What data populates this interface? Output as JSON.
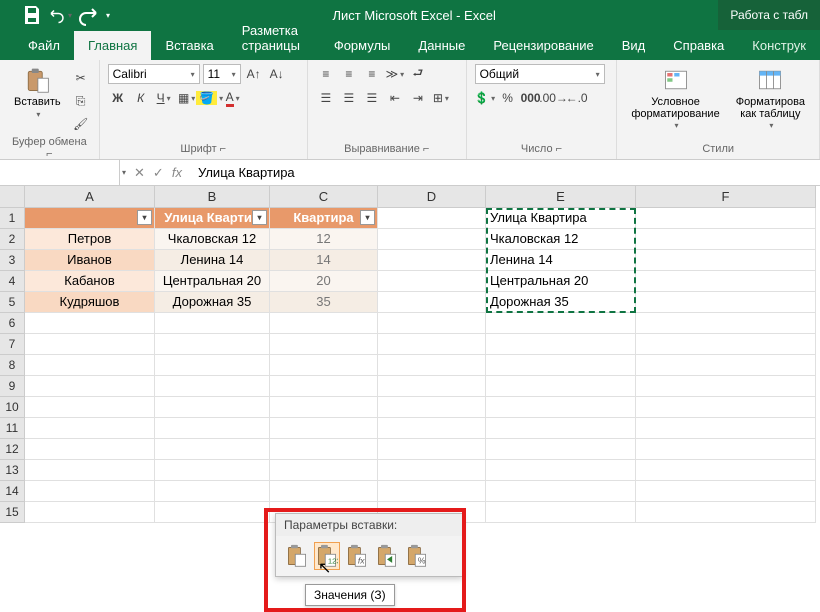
{
  "app": {
    "title": "Лист Microsoft Excel  -  Excel",
    "right_tag": "Работа с табл"
  },
  "tabs": {
    "file": "Файл",
    "home": "Главная",
    "insert": "Вставка",
    "layout": "Разметка страницы",
    "formulas": "Формулы",
    "data": "Данные",
    "review": "Рецензирование",
    "view": "Вид",
    "help": "Справка",
    "design": "Конструк"
  },
  "ribbon": {
    "clipboard": {
      "label": "Буфер обмена",
      "paste": "Вставить"
    },
    "font": {
      "label": "Шрифт",
      "name": "Calibri",
      "size": "11"
    },
    "alignment": {
      "label": "Выравнивание"
    },
    "number": {
      "label": "Число",
      "format": "Общий"
    },
    "styles": {
      "label": "Стили",
      "cond": "Условное\nформатирование",
      "table": "Форматирова\nкак таблицу"
    }
  },
  "formula_bar": {
    "name_box": "",
    "value": "Улица Квартира"
  },
  "columns": [
    "A",
    "B",
    "C",
    "D",
    "E",
    "F"
  ],
  "table": {
    "headers": {
      "a": "",
      "b": "Улица Квартир",
      "c": "Квартира"
    },
    "rows": [
      {
        "a": "Петров",
        "b": "Чкаловская 12",
        "c": "12"
      },
      {
        "a": "Иванов",
        "b": "Ленина 14",
        "c": "14"
      },
      {
        "a": "Кабанов",
        "b": "Центральная 20",
        "c": "20"
      },
      {
        "a": "Кудряшов",
        "b": "Дорожная 35",
        "c": "35"
      }
    ]
  },
  "paste_col": [
    "Улица Квартира",
    "Чкаловская 12",
    "Ленина 14",
    "Центральная 20",
    "Дорожная 35"
  ],
  "popup": {
    "title": "Параметры вставки:",
    "tooltip": "Значения (З)"
  }
}
